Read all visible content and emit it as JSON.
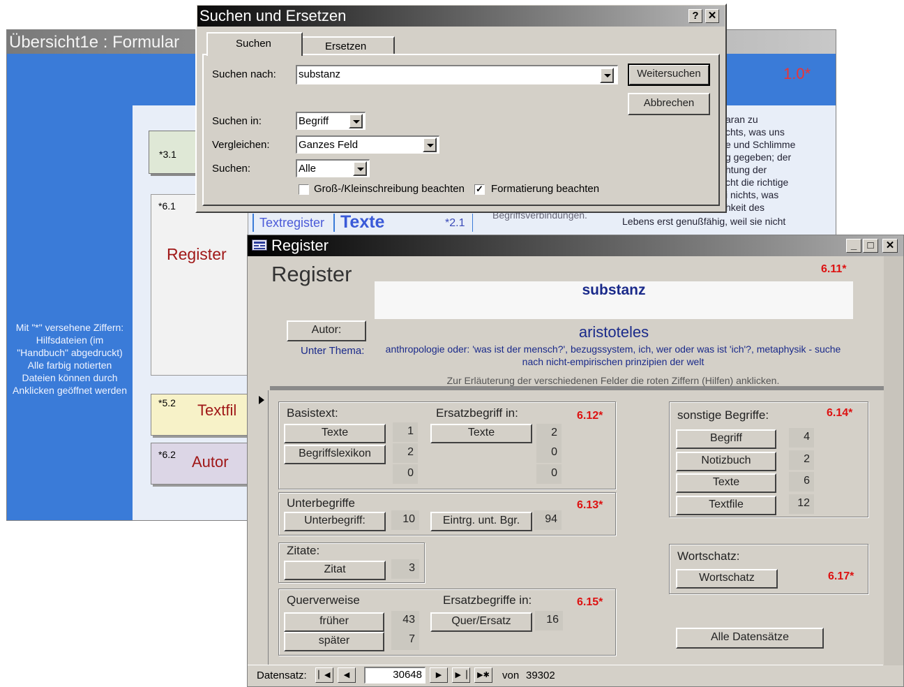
{
  "bg_form": {
    "title": "Übersicht1e : Formular",
    "corner_red": "1.0*",
    "side_note": "Mit \"*\" versehene Ziffern: Hilfsdateien (im \"Handbuch\" abgedruckt) Alle farbig notierten Dateien können durch Anklicken geöffnet werden",
    "card_31": "*3.1",
    "card_61": "*6.1",
    "register_label": "Register",
    "card_52": "*5.2",
    "textfil_label": "Textfil",
    "card_62": "*6.2",
    "autor_label": "Autor",
    "textregister": "Textregister",
    "texte_big": "Texte",
    "num_21": "*2.1",
    "begriffs_partial": "Begriffsverbindungen.",
    "right_text_lines": [
      "aran zu",
      "chts, was uns",
      "e und Schlimme",
      "g gegeben; der",
      "htung der",
      "cht die richtige",
      "i nichts, was",
      "hkeit des"
    ],
    "lebens_line": "Lebens erst genußfähig, weil sie nicht"
  },
  "find_dialog": {
    "title": "Suchen und Ersetzen",
    "help_label": "?",
    "close_label": "✕",
    "tabs": [
      "Suchen",
      "Ersetzen"
    ],
    "search_for_label": "Suchen nach:",
    "search_value": "substanz",
    "find_next": "Weitersuchen",
    "cancel": "Abbrechen",
    "look_in_label": "Suchen in:",
    "look_in_value": "Begriff",
    "match_label": "Vergleichen:",
    "match_value": "Ganzes Feld",
    "search_dir_label": "Suchen:",
    "search_dir_value": "Alle",
    "match_case_label": "Groß-/Kleinschreibung beachten",
    "match_case_checked": false,
    "format_label": "Formatierung beachten",
    "format_checked": true
  },
  "register_window": {
    "title": "Register",
    "heading": "Register",
    "red_611": "6.11*",
    "term": "substanz",
    "autor_button": "Autor:",
    "author": "aristoteles",
    "unter_thema_label": "Unter Thema:",
    "thema_text": "anthropologie oder: 'was ist der mensch?', bezugssystem, ich, wer oder was ist 'ich'?, metaphysik - suche nach nicht-empirischen prinzipien der welt",
    "hint": "Zur Erläuterung der verschiedenen Felder die roten Ziffern (Hilfen) anklicken.",
    "basistext": {
      "label": "Basistext:",
      "btn_texte": "Texte",
      "btn_begriffslexikon": "Begriffslexikon",
      "counts": [
        "1",
        "2",
        "0"
      ],
      "ersatz_label": "Ersatzbegriff in:",
      "ersatz_btn": "Texte",
      "ersatz_counts": [
        "2",
        "0",
        "0"
      ],
      "red": "6.12*"
    },
    "unterbegriffe": {
      "label": "Unterbegriffe",
      "btn_unterbegriff": "Unterbegriff:",
      "count_unterbegriff": "10",
      "btn_eintrag": "Eintrg. unt. Bgr.",
      "count_eintrag": "94",
      "red": "6.13*"
    },
    "zitate": {
      "label": "Zitate:",
      "btn": "Zitat",
      "count": "3"
    },
    "querverweise": {
      "label": "Querverweise",
      "btn_frueher": "früher",
      "count_frueher": "43",
      "btn_spaeter": "später",
      "count_spaeter": "7",
      "ersatz_label": "Ersatzbegriffe in:",
      "btn_quer": "Quer/Ersatz",
      "count_quer": "16",
      "red": "6.15*"
    },
    "sonstige": {
      "label": "sonstige Begriffe:",
      "red": "6.14*",
      "items": [
        {
          "label": "Begriff",
          "count": "4"
        },
        {
          "label": "Notizbuch",
          "count": "2"
        },
        {
          "label": "Texte",
          "count": "6"
        },
        {
          "label": "Textfile",
          "count": "12"
        }
      ]
    },
    "wortschatz": {
      "label": "Wortschatz:",
      "btn": "Wortschatz",
      "red": "6.17*"
    },
    "alle_btn": "Alle Datensätze",
    "nav": {
      "label": "Datensatz:",
      "current": "30648",
      "of_label": "von",
      "total": "39302"
    }
  }
}
